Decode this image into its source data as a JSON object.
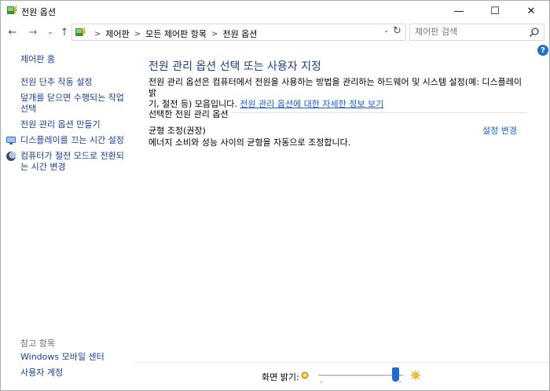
{
  "window": {
    "title": "전원 옵션",
    "min_glyph": "—",
    "max_glyph": "☐",
    "close_glyph": "✕"
  },
  "nav": {
    "back_glyph": "←",
    "forward_glyph": "→",
    "recent_glyph": "⌄",
    "up_glyph": "↑",
    "breadcrumbs": [
      "제어판",
      "모든 제어판 항목",
      "전원 옵션"
    ],
    "breadcrumb_sep": ">",
    "dropdown_glyph": "⌄",
    "refresh_glyph": "↻"
  },
  "search": {
    "placeholder": "제어판 검색",
    "icon": "search-icon"
  },
  "help": {
    "glyph": "?"
  },
  "sidebar": {
    "home": "제어판 홈",
    "links": [
      "전원 단추 작동 설정",
      "덮개를 닫으면 수행되는 작업",
      "선택",
      "전원 관리 옵션 만들기",
      "디스플레이를 끄는 시간 설정",
      "컴퓨터가 절전 모드로 전환되",
      "는 시간 변경"
    ],
    "see_also_title": "참고 항목",
    "see_also": [
      "Windows 모바일 센터",
      "사용자 계정"
    ]
  },
  "main": {
    "title": "전원 관리 옵션 선택 또는 사용자 지정",
    "description_line1": "전원 관리 옵션은 컴퓨터에서 전원을 사용하는 방법을 관리하는 하드웨어 및 시스템 설정(예: 디스플레이 밝",
    "description_line2": "기, 절전 등) 모음입니다.",
    "description_link": "전원 관리 옵션에 대한 자세한 정보 보기",
    "group_header": "선택한 전원 관리 옵션",
    "plan": {
      "name": "균형 조정(권장)",
      "description": "에너지 소비와 성능 사이의 균형을 자동으로 조정합니다.",
      "change_link": "설정 변경"
    }
  },
  "brightness": {
    "label": "화면 밝기:",
    "value_fraction": 0.95
  },
  "colors": {
    "title_blue": "#1e3f8a",
    "link_blue": "#1a5dd6",
    "accent": "#1f6bd6"
  }
}
